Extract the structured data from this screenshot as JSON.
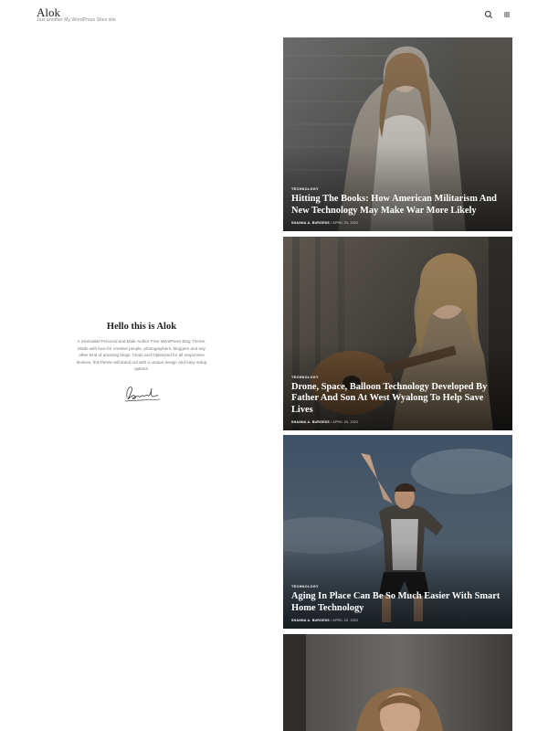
{
  "header": {
    "site_title": "Alok",
    "tagline": "Just another My WordPress Sites site",
    "icons": [
      "search-icon",
      "menu-icon"
    ]
  },
  "intro": {
    "title": "Hello this is Alok",
    "text": "A minimalist Personal and Multi-Author Free WordPress Blog Theme. Made with love for creative people, photographers, bloggers and any other kind of amazing blogs. Clean and Optimized for all responsive devices, this theme will stand out with a unique design and easy setup options.",
    "signature_icon": "signature-icon"
  },
  "posts": [
    {
      "category": "TECHNOLOGY",
      "title": "Hitting The Books: How American Militarism And New Technology May Make War More Likely",
      "author": "SHANNA A. BURGESS",
      "date": "APRIL 20, 2022"
    },
    {
      "category": "TECHNOLOGY",
      "title": "Drone, Space, Balloon Technology Developed By Father And Son At West Wyalong To Help Save Lives",
      "author": "SHANNA A. BURGESS",
      "date": "APRIL 20, 2022"
    },
    {
      "category": "TECHNOLOGY",
      "title": "Aging In Place Can Be So Much Easier With Smart Home Technology",
      "author": "SHANNA A. BURGESS",
      "date": "APRIL 20, 2022"
    }
  ],
  "colors": {
    "background": "#ffffff",
    "text": "#222222",
    "overlay_text": "#ffffff"
  }
}
